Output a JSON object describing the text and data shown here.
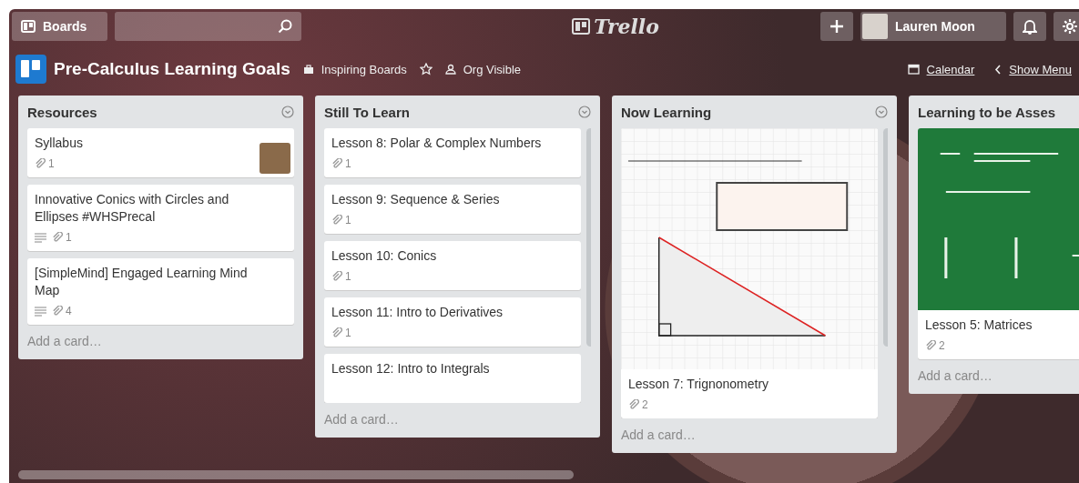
{
  "top_bar": {
    "boards_button": "Boards",
    "logo": "Trello",
    "user_name": "Lauren Moon"
  },
  "board": {
    "title": "Pre-Calculus Learning Goals",
    "team": "Inspiring Boards",
    "visibility": "Org Visible",
    "calendar": "Calendar",
    "show_menu": "Show Menu"
  },
  "lists": [
    {
      "title": "Resources",
      "scrollbar": false,
      "add_card": "Add a card…",
      "cards": [
        {
          "kind": "plain",
          "title": "Syllabus",
          "description": false,
          "attachments": "1",
          "member": true
        },
        {
          "kind": "plain",
          "title": "Innovative Conics with Circles and Ellipses #WHSPrecal",
          "description": true,
          "attachments": "1",
          "member": false
        },
        {
          "kind": "plain",
          "title": "[SimpleMind] Engaged Learning Mind Map",
          "description": true,
          "attachments": "4",
          "member": false
        }
      ]
    },
    {
      "title": "Still To Learn",
      "scrollbar": true,
      "add_card": "Add a card…",
      "cards": [
        {
          "kind": "plain",
          "title": "Lesson 8: Polar & Complex Numbers",
          "description": false,
          "attachments": "1",
          "member": false
        },
        {
          "kind": "plain",
          "title": "Lesson 9: Sequence & Series",
          "description": false,
          "attachments": "1",
          "member": false
        },
        {
          "kind": "plain",
          "title": "Lesson 10: Conics",
          "description": false,
          "attachments": "1",
          "member": false
        },
        {
          "kind": "plain",
          "title": "Lesson 11: Intro to Derivatives",
          "description": false,
          "attachments": "1",
          "member": false
        },
        {
          "kind": "plain",
          "title": "Lesson 12: Intro to Integrals",
          "description": false,
          "member": false
        }
      ]
    },
    {
      "title": "Now Learning",
      "scrollbar": true,
      "add_card": "Add a card…",
      "cards": [
        {
          "kind": "triangle",
          "title": "Lesson 7: Trignonometry",
          "description": false,
          "attachments": "2",
          "member": false
        }
      ]
    },
    {
      "title": "Learning to be Asses",
      "scrollbar": false,
      "add_card": "Add a card…",
      "cards": [
        {
          "kind": "chalkboard",
          "title": "Lesson 5: Matrices",
          "description": false,
          "attachments": "2"
        }
      ]
    }
  ]
}
